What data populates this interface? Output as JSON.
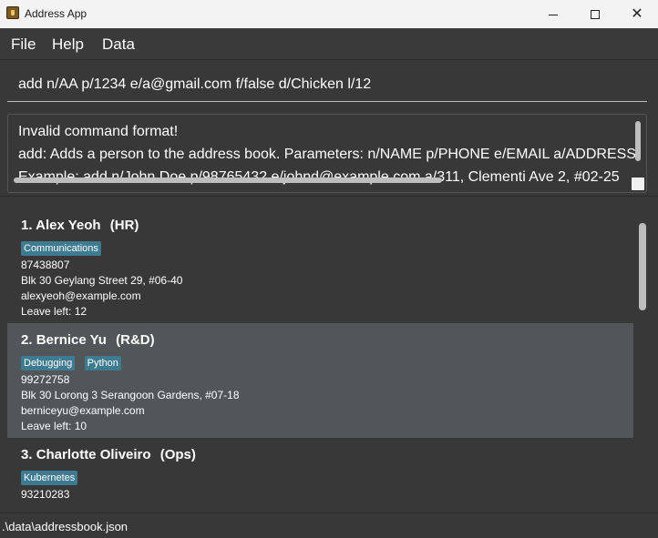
{
  "window": {
    "title": "Address App"
  },
  "menu": {
    "items": [
      "File",
      "Help",
      "Data"
    ]
  },
  "command": {
    "value": "add n/AA p/1234 e/a@gmail.com f/false d/Chicken l/12"
  },
  "result": {
    "lines": [
      "Invalid command format!",
      "add: Adds a person to the address book. Parameters: n/NAME p/PHONE e/EMAIL a/ADDRESS",
      "Example: add n/John Doe p/98765432 e/johnd@example.com a/311, Clementi Ave 2, #02-25"
    ]
  },
  "persons": [
    {
      "index": "1.",
      "name": "Alex Yeoh",
      "dept": "(HR)",
      "tags": [
        "Communications"
      ],
      "phone": "87438807",
      "address": "Blk 30 Geylang Street 29, #06-40",
      "email": "alexyeoh@example.com",
      "leave": "Leave left: 12"
    },
    {
      "index": "2.",
      "name": "Bernice Yu",
      "dept": "(R&D)",
      "tags": [
        "Debugging",
        "Python"
      ],
      "phone": "99272758",
      "address": "Blk 30 Lorong 3 Serangoon Gardens, #07-18",
      "email": "berniceyu@example.com",
      "leave": "Leave left: 10"
    },
    {
      "index": "3.",
      "name": "Charlotte Oliveiro",
      "dept": "(Ops)",
      "tags": [
        "Kubernetes"
      ],
      "phone": "93210283"
    }
  ],
  "status": {
    "file_path": ".\\data\\addressbook.json"
  },
  "colors": {
    "background": "#383838",
    "selected_card": "#515658",
    "tag": "#3e7b91",
    "title_bar": "#f3f3f3"
  }
}
